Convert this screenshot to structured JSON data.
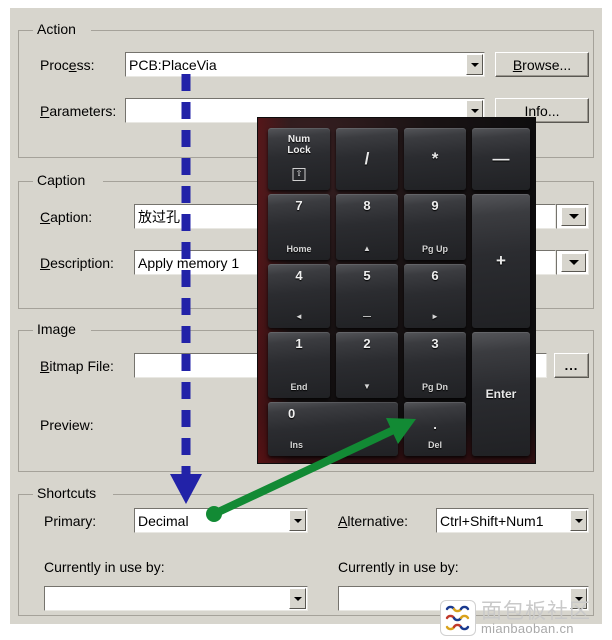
{
  "dialog": {
    "groups": {
      "action": "Action",
      "caption": "Caption",
      "image": "Image",
      "shortcuts": "Shortcuts"
    },
    "action": {
      "process_label_pre": "Proc",
      "process_label_accel": "e",
      "process_label_post": "ss:",
      "process_value": "PCB:PlaceVia",
      "browse_label_accel": "B",
      "browse_label_post": "rowse...",
      "parameters_label_accel": "P",
      "parameters_label_post": "arameters:",
      "parameters_value": "",
      "info_label_accel": "I",
      "info_label_post": "nfo..."
    },
    "caption": {
      "caption_label_accel": "C",
      "caption_label_post": "aption:",
      "caption_value": "放过孔",
      "description_label_accel": "D",
      "description_label_post": "escription:",
      "description_value": "Apply memory 1"
    },
    "image": {
      "bitmap_label_accel": "B",
      "bitmap_label_post": "itmap File:",
      "bitmap_value": "",
      "browse_dots": "...",
      "preview_label": "Preview:"
    },
    "shortcuts": {
      "primary_label": "Primary:",
      "primary_value": "Decimal",
      "alternative_label_accel": "A",
      "alternative_label_post": "lternative:",
      "alternative_value": "Ctrl+Shift+Num1",
      "in_use_left_label": "Currently in use by:",
      "in_use_left_value": "",
      "in_use_right_label": "Currently in use by:",
      "in_use_right_value": ""
    }
  },
  "numpad": {
    "keys": [
      {
        "main": "Num",
        "main2": "Lock",
        "box": "⇧",
        "type": "numlock"
      },
      {
        "glyph": "/",
        "type": "glyph"
      },
      {
        "glyph": "*",
        "type": "glyph"
      },
      {
        "glyph": "—",
        "type": "glyph"
      },
      {
        "main": "7",
        "sub": "Home",
        "type": "dual"
      },
      {
        "main": "8",
        "sub": "▲",
        "type": "dual"
      },
      {
        "main": "9",
        "sub": "Pg Up",
        "type": "dual"
      },
      {
        "glyph": "+",
        "type": "glyph"
      },
      {
        "main": "4",
        "sub": "◄",
        "type": "dual"
      },
      {
        "main": "5",
        "sub": "—",
        "type": "dual"
      },
      {
        "main": "6",
        "sub": "►",
        "type": "dual"
      },
      {
        "main": "1",
        "sub": "End",
        "type": "dual"
      },
      {
        "main": "2",
        "sub": "▼",
        "type": "dual"
      },
      {
        "main": "3",
        "sub": "Pg Dn",
        "type": "dual"
      },
      {
        "glyph": "Enter",
        "type": "word"
      },
      {
        "main": "0",
        "sub": "Ins",
        "type": "dual"
      },
      {
        "main": ".",
        "sub": "Del",
        "type": "dual"
      }
    ]
  },
  "annotations": {
    "blue_arrow_color": "#2222a8",
    "green_arrow_color": "#128a34"
  },
  "watermark": {
    "cn": "面包板社区",
    "en": "mianbaoban.cn"
  }
}
